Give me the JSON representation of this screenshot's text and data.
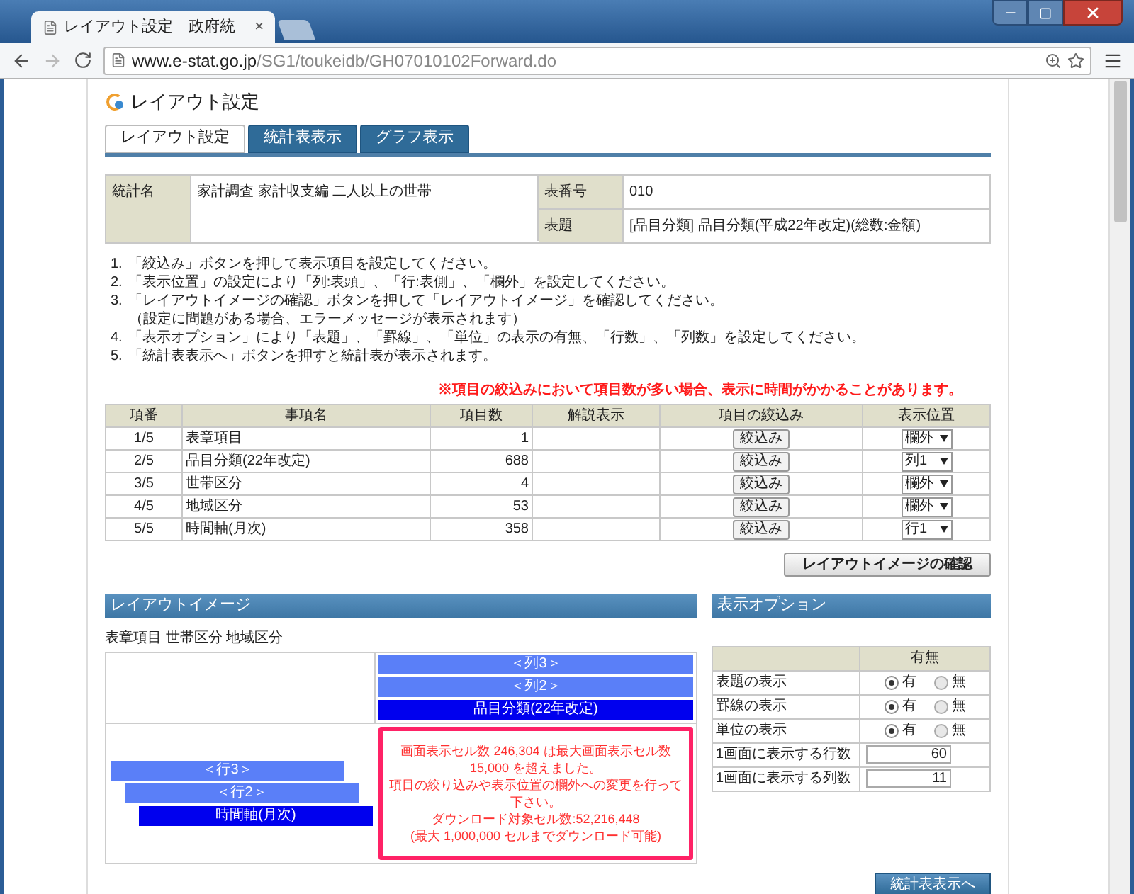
{
  "browser": {
    "tab_title": "レイアウト設定　政府統",
    "tab_close": "×",
    "url_host": "www.e-stat.go.jp",
    "url_path": "/SG1/toukeidb/GH07010102Forward.do"
  },
  "page_title": "レイアウト設定",
  "tabs": [
    {
      "label": "レイアウト設定",
      "selected": true
    },
    {
      "label": "統計表表示",
      "selected": false
    },
    {
      "label": "グラフ表示",
      "selected": false
    }
  ],
  "info": {
    "left": {
      "label": "統計名",
      "value": "家計調査 家計収支編 二人以上の世帯"
    },
    "right": [
      {
        "label": "表番号",
        "value": "010"
      },
      {
        "label": "表題",
        "value": "[品目分類] 品目分類(平成22年改定)(総数:金額)"
      }
    ]
  },
  "instructions": [
    {
      "number": "1.",
      "text": "「絞込み」ボタンを押して表示項目を設定してください。"
    },
    {
      "number": "2.",
      "text": "「表示位置」の設定により「列:表頭」、「行:表側」、「欄外」を設定してください。"
    },
    {
      "number": "3.",
      "text": "「レイアウトイメージの確認」ボタンを押して「レイアウトイメージ」を確認してください。",
      "note": "（設定に問題がある場合、エラーメッセージが表示されます）"
    },
    {
      "number": "4.",
      "text": "「表示オプション」により「表題」、「罫線」、「単位」の表示の有無、「行数」、「列数」を設定してください。"
    },
    {
      "number": "5.",
      "text": "「統計表表示へ」ボタンを押すと統計表が表示されます。"
    }
  ],
  "warning": "※項目の絞込みにおいて項目数が多い場合、表示に時間がかかることがあります。",
  "items_table": {
    "columns": [
      "項番",
      "事項名",
      "項目数",
      "解説表示",
      "項目の絞込み",
      "表示位置"
    ],
    "rows": [
      {
        "index": "1/5",
        "name": "表章項目",
        "count": "1",
        "button": "絞込み",
        "position": "欄外"
      },
      {
        "index": "2/5",
        "name": "品目分類(22年改定)",
        "count": "688",
        "button": "絞込み",
        "position": "列1"
      },
      {
        "index": "3/5",
        "name": "世帯区分",
        "count": "4",
        "button": "絞込み",
        "position": "欄外"
      },
      {
        "index": "4/5",
        "name": "地域区分",
        "count": "53",
        "button": "絞込み",
        "position": "欄外"
      },
      {
        "index": "5/5",
        "name": "時間軸(月次)",
        "count": "358",
        "button": "絞込み",
        "position": "行1"
      }
    ]
  },
  "confirm_button": "レイアウトイメージの確認",
  "layout_image": {
    "title": "レイアウトイメージ",
    "caption": "表章項目 世帯区分 地域区分",
    "column_bars": [
      {
        "label": "＜列3＞",
        "kind": "placeholder"
      },
      {
        "label": "＜列2＞",
        "kind": "placeholder"
      },
      {
        "label": "品目分類(22年改定)",
        "kind": "item"
      }
    ],
    "row_bars": [
      {
        "label": "＜行3＞",
        "kind": "placeholder"
      },
      {
        "label": "＜行2＞",
        "kind": "placeholder"
      },
      {
        "label": "時間軸(月次)",
        "kind": "item"
      }
    ],
    "error": [
      "画面表示セル数 246,304 は最大画面表示セル数",
      "15,000 を超えました。",
      "項目の絞り込みや表示位置の欄外への変更を行って下さい。",
      "ダウンロード対象セル数:52,216,448",
      "(最大 1,000,000 セルまでダウンロード可能)"
    ]
  },
  "options": {
    "title": "表示オプション",
    "column": "有無",
    "rows": [
      {
        "kind": "radio",
        "label": "表題の表示",
        "choices": [
          {
            "label": "有",
            "selected": true
          },
          {
            "label": "無",
            "selected": false
          }
        ]
      },
      {
        "kind": "radio",
        "label": "罫線の表示",
        "choices": [
          {
            "label": "有",
            "selected": true
          },
          {
            "label": "無",
            "selected": false
          }
        ]
      },
      {
        "kind": "radio",
        "label": "単位の表示",
        "choices": [
          {
            "label": "有",
            "selected": true
          },
          {
            "label": "無",
            "selected": false
          }
        ]
      },
      {
        "kind": "input",
        "label": "1画面に表示する行数",
        "value": "60"
      },
      {
        "kind": "input",
        "label": "1画面に表示する列数",
        "value": "11"
      }
    ]
  },
  "next_button": "統計表表示へ"
}
